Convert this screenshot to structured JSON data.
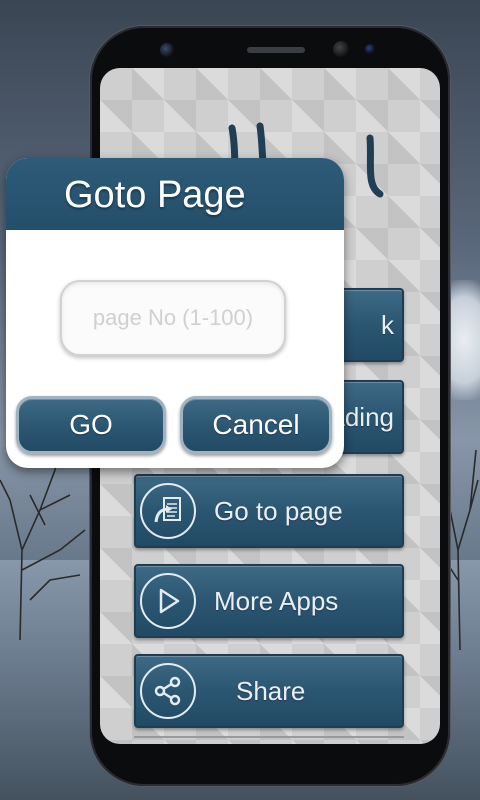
{
  "dialog": {
    "title": "Goto Page",
    "input_placeholder": "page No (1-100)",
    "input_value": "",
    "go_label": "GO",
    "cancel_label": "Cancel"
  },
  "menu": {
    "items": [
      {
        "label": "k",
        "icon": "unknown-icon"
      },
      {
        "label": "ading",
        "icon": "unknown-icon"
      },
      {
        "label": "Go to page",
        "icon": "goto-page-icon"
      },
      {
        "label": "More Apps",
        "icon": "play-icon"
      },
      {
        "label": "Share",
        "icon": "share-icon"
      }
    ]
  },
  "colors": {
    "primary": "#2b5672",
    "dialog_header": "#2d5b78",
    "dialog_background": "#ffffff",
    "button_text": "#ffffff"
  }
}
